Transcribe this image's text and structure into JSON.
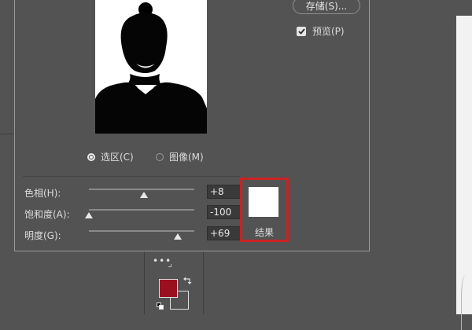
{
  "dialog": {
    "save_label": "存储(S)...",
    "preview_label": "预览(P)",
    "preview_checked": true,
    "radios": [
      {
        "label": "选区(C)",
        "selected": true
      },
      {
        "label": "图像(M)",
        "selected": false
      }
    ],
    "params": [
      {
        "label": "色相(H):",
        "value": "+8",
        "slider_fraction": 0.52
      },
      {
        "label": "饱和度(A):",
        "value": "-100",
        "slider_fraction": 0.0
      },
      {
        "label": "明度(G):",
        "value": "+69",
        "slider_fraction": 0.84
      }
    ],
    "result": {
      "label": "结果",
      "color": "#ffffff"
    }
  },
  "tools": {
    "more_icon": "ellipsis-icon",
    "foreground_color": "#9b1020",
    "background_color": "#535353"
  },
  "colors": {
    "highlight": "#cc2222",
    "panel": "#535353"
  }
}
